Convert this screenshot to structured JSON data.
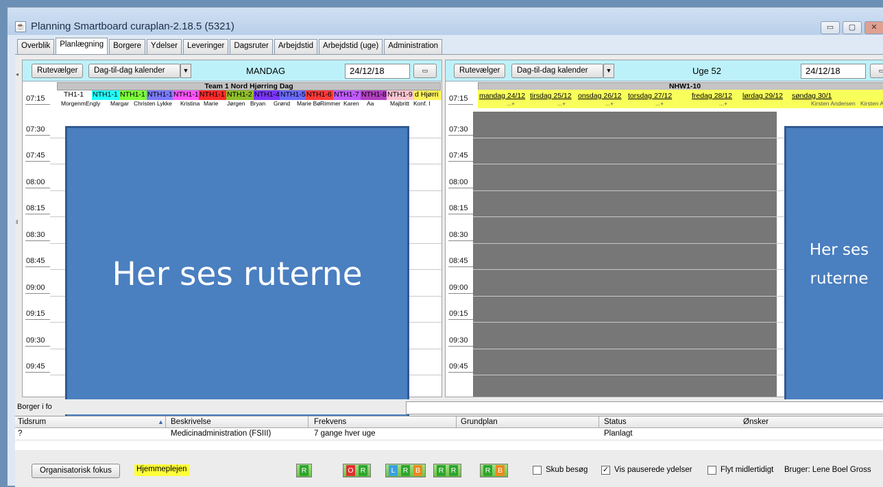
{
  "window": {
    "title": "Planning Smartboard curaplan-2.18.5 (5321)",
    "controls": [
      "▭",
      "▢",
      "✕"
    ]
  },
  "tabs": [
    "Overblik",
    "Planlægning",
    "Borgere",
    "Ydelser",
    "Leveringer",
    "Dagsruter",
    "Arbejdstid",
    "Arbejdstid (uge)",
    "Administration"
  ],
  "active_tab": "Planlægning",
  "left_panel": {
    "rutevaelger": "Rutevælger",
    "view_select": "Dag-til-dag kalender",
    "day": "MANDAG",
    "date": "24/12/18",
    "team": "Team 1 Nord Hjørring Dag",
    "columns": [
      {
        "label": " TH1-1",
        "color": "#ffffff"
      },
      {
        "label": "NTH1-1",
        "color": "#22ffff"
      },
      {
        "label": "NTH1-1",
        "color": "#7cff38"
      },
      {
        "label": "NTH1-1",
        "color": "#7a7aff"
      },
      {
        "label": "NTH1-1",
        "color": "#ff55ff"
      },
      {
        "label": "NTH1-1",
        "color": "#ff2a2a"
      },
      {
        "label": "NTH1-2",
        "color": "#8fbf2a"
      },
      {
        "label": "NTH1-4",
        "color": "#7a36ff"
      },
      {
        "label": "NTH1-5",
        "color": "#6a6aff"
      },
      {
        "label": "NTH1-6",
        "color": "#ff3a3a"
      },
      {
        "label": "NTH1-7",
        "color": "#c05aff"
      },
      {
        "label": "NTH1-8",
        "color": "#b040c0"
      },
      {
        "label": "NTH1-9",
        "color": "#ffc6d2"
      },
      {
        "label": "d Hjørri",
        "color": "#fff35a"
      }
    ],
    "names": [
      "Morgenmal",
      "Engly",
      "Margar",
      "Christen",
      "Lykke",
      "Kristina",
      "Marie",
      "Jørgen",
      "Bryan",
      "Grønd",
      "Marie Bø",
      "Rimmer",
      "Karen",
      "Aa",
      "Majbritt",
      "Konf. I"
    ],
    "times": [
      "07:15",
      "07:30",
      "07:45",
      "08:00",
      "08:15",
      "08:30",
      "08:45",
      "09:00",
      "09:15",
      "09:30",
      "09:45"
    ]
  },
  "right_panel": {
    "rutevaelger": "Rutevælger",
    "view_select": "Dag-til-dag kalender",
    "week": "Uge 52",
    "date": "24/12/18",
    "team": "NHW1-10",
    "days": [
      "mandag 24/12",
      "tirsdag 25/12",
      "onsdag 26/12",
      "torsdag 27/12",
      "fredag 28/12",
      "lørdag 29/12",
      "søndag 30/1"
    ],
    "day_note": "...+",
    "weekend_names": [
      "Kirsten Andersen",
      "Kirsten Andersen"
    ],
    "times": [
      "07:15",
      "07:30",
      "07:45",
      "08:00",
      "08:15",
      "08:30",
      "08:45",
      "09:00",
      "09:15",
      "09:30",
      "09:45"
    ]
  },
  "overlay_left": "Her ses ruterne",
  "overlay_right": "Her ses ruterne",
  "borger_label": "Borger i fo",
  "table": {
    "headers": [
      "Tidsrum",
      "Beskrivelse",
      "Frekvens",
      "Grundplan",
      "Status",
      "Ønsker"
    ],
    "rows": [
      [
        "?",
        "Medicinadministration (FSIII)",
        "7 gange hver uge",
        "",
        "Planlagt",
        ""
      ]
    ]
  },
  "bottom": {
    "org_button": "Organisatorisk fokus",
    "unit": "Hjemmeplejen",
    "pills": [
      [
        "R"
      ],
      [
        "O",
        "R"
      ],
      [
        "L",
        "R",
        "B"
      ],
      [
        "R",
        "R"
      ],
      [
        "R",
        "B"
      ]
    ],
    "skub": "Skub besøg",
    "vis": "Vis pauserede ydelser",
    "flyt": "Flyt midlertidigt",
    "user": "Bruger: Lene Boel Gross",
    "skub_checked": false,
    "vis_checked": true,
    "flyt_checked": false
  }
}
